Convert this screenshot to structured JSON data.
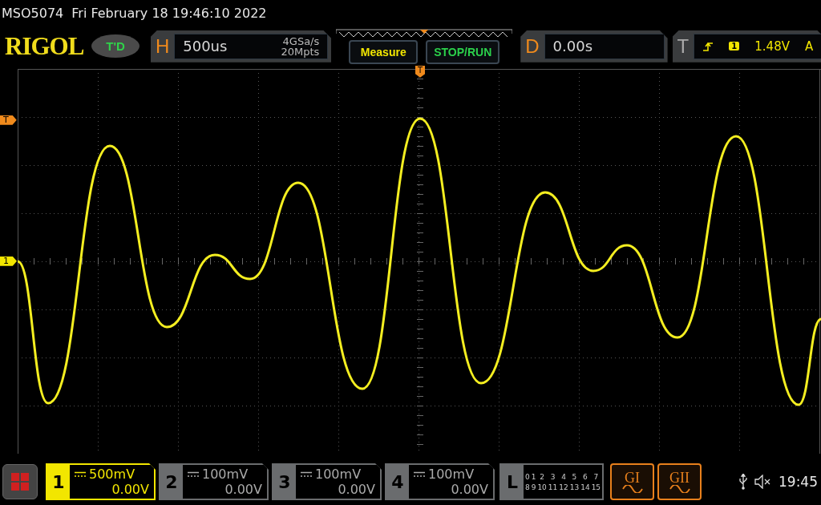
{
  "header": {
    "model": "MSO5074",
    "datetime": "Fri February 18 19:46:10 2022"
  },
  "top_bar": {
    "logo": "RIGOL",
    "mode_badge": "T'D",
    "horizontal": {
      "label": "H",
      "timebase": "500us",
      "sample_rate": "4GSa/s",
      "memory_depth": "20Mpts"
    },
    "buttons": [
      {
        "label": "Measure",
        "color": "#f2e600"
      },
      {
        "label": "STOP/RUN",
        "color": "#2bd14b"
      }
    ],
    "delay": {
      "label": "D",
      "value": "0.00s"
    },
    "trigger": {
      "label": "T",
      "source": "1",
      "level": "1.48V",
      "mode": "A"
    }
  },
  "screen": {
    "trigger_position_marker": "T",
    "trigger_level_marker": "T",
    "channel_marker": "1"
  },
  "channels": [
    {
      "number": "1",
      "scale": "500mV",
      "offset": "0.00V",
      "selected": true
    },
    {
      "number": "2",
      "scale": "100mV",
      "offset": "0.00V",
      "selected": false
    },
    {
      "number": "3",
      "scale": "100mV",
      "offset": "0.00V",
      "selected": false
    },
    {
      "number": "4",
      "scale": "100mV",
      "offset": "0.00V",
      "selected": false
    }
  ],
  "logic": {
    "label": "L",
    "bits_row_1": [
      "0",
      "1",
      "2",
      "3",
      "4",
      "5",
      "6",
      "7"
    ],
    "bits_row_2": [
      "8",
      "9",
      "10",
      "11",
      "12",
      "13",
      "14",
      "15"
    ]
  },
  "generators": [
    "GI",
    "GII"
  ],
  "status": {
    "time": "19:45"
  }
}
